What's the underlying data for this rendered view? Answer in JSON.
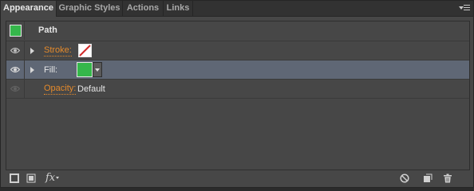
{
  "tabs": [
    {
      "label": "Appearance",
      "active": true
    },
    {
      "label": "Graphic Styles",
      "active": false
    },
    {
      "label": "Actions",
      "active": false
    },
    {
      "label": "Links",
      "active": false
    }
  ],
  "panel_menu_icon": "panel-menu-icon",
  "header": {
    "title": "Path",
    "swatch_color": "#35b74b"
  },
  "rows": {
    "stroke": {
      "label": "Stroke:",
      "swatch": "none-swatch (white with red slash)"
    },
    "fill": {
      "label": "Fill:",
      "swatch_color": "#35b74b"
    },
    "opacity": {
      "label": "Opacity:",
      "value": "Default"
    }
  },
  "footer": {
    "fx_label": "fx",
    "icons": [
      "add-new-stroke-icon",
      "add-new-fill-icon",
      "fx-icon",
      "clear-appearance-icon",
      "duplicate-item-icon",
      "delete-item-icon"
    ]
  },
  "colors": {
    "accent_link": "#e58a2b",
    "selected_row": "#5f6775",
    "panel_bg": "#474747"
  }
}
